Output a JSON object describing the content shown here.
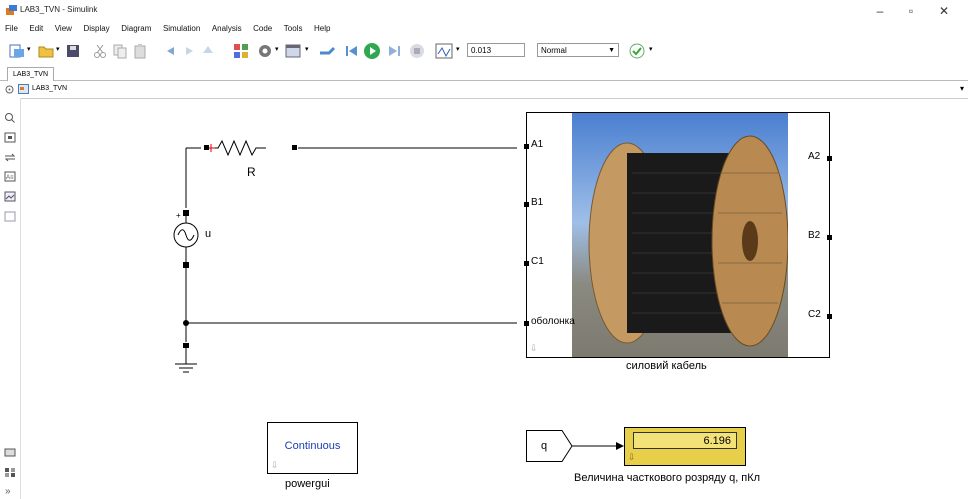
{
  "window": {
    "title": "LAB3_TVN - Simulink"
  },
  "menu": [
    "File",
    "Edit",
    "View",
    "Display",
    "Diagram",
    "Simulation",
    "Analysis",
    "Code",
    "Tools",
    "Help"
  ],
  "toolbar": {
    "stop_time": "0.013",
    "sim_mode": "Normal"
  },
  "tab": {
    "label": "LAB3_TVN"
  },
  "breadcrumb": {
    "label": "LAB3_TVN"
  },
  "blocks": {
    "resistor_label": "R",
    "source_label": "u",
    "cable": {
      "name": "силовий кабель",
      "left_ports": [
        "A1",
        "B1",
        "C1",
        "оболонка"
      ],
      "right_ports": [
        "A2",
        "B2",
        "C2"
      ]
    },
    "powergui": {
      "text": "Continuous",
      "name": "powergui"
    },
    "goto_q": {
      "text": "q"
    },
    "display": {
      "value": "6.196",
      "name": "Величина часткового розряду q, пКл"
    }
  }
}
